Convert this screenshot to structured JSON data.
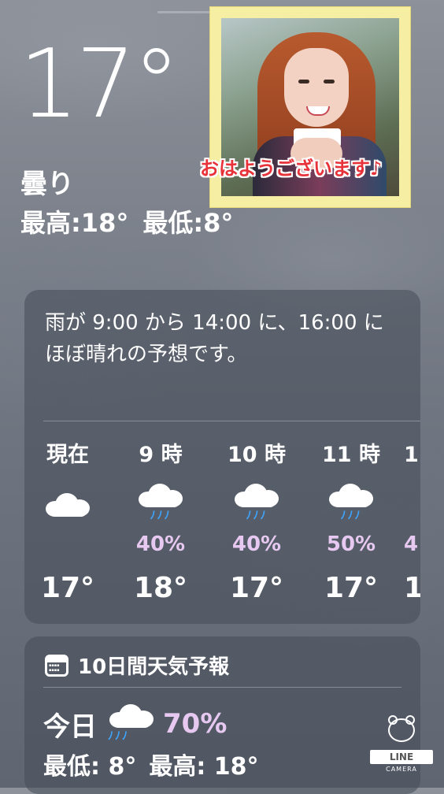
{
  "current": {
    "temperature": "17°",
    "condition": "曇り",
    "high": "最高:18°",
    "low": "最低:8°"
  },
  "photo": {
    "caption": "おはようございます♪",
    "frame_color": "#f6eea2",
    "caption_color": "#e8323a"
  },
  "hourly": {
    "summary": "雨が 9:00 から 14:00 に、16:00 にほぼ晴れの予想です。",
    "items": [
      {
        "label": "現在",
        "icon": "cloud-icon",
        "precip": "",
        "temp": "17°"
      },
      {
        "label": "9 時",
        "icon": "cloud-rain-icon",
        "precip": "40%",
        "temp": "18°"
      },
      {
        "label": "10 時",
        "icon": "cloud-rain-icon",
        "precip": "40%",
        "temp": "17°"
      },
      {
        "label": "11 時",
        "icon": "cloud-rain-icon",
        "precip": "50%",
        "temp": "17°"
      },
      {
        "label": "1",
        "icon": "cloud-rain-icon",
        "precip": "4",
        "temp": "1"
      }
    ]
  },
  "forecast": {
    "header": "10日間天気予報",
    "header_icon": "calendar-icon",
    "today": {
      "label": "今日",
      "icon": "cloud-rain-icon",
      "precip": "70%",
      "low": "最低: 8°",
      "high": "最高: 18°"
    }
  },
  "watermark": {
    "brand": "LINE",
    "sub": "CAMERA"
  },
  "colors": {
    "precip_text": "#e6c8f0",
    "rain_drops": "#3ea6ff"
  }
}
